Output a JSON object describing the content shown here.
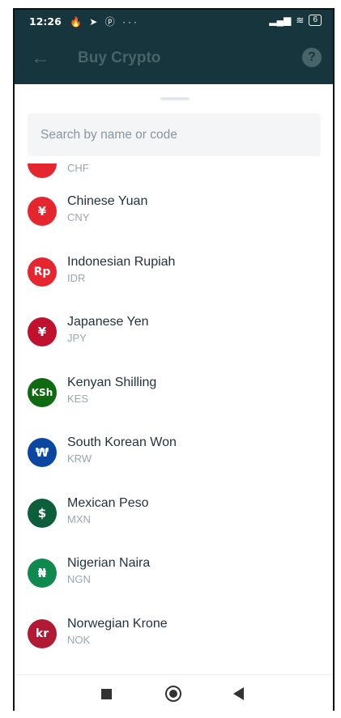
{
  "status_bar": {
    "time": "12:26",
    "left_icons": "🔥 ➤ ⓟ ···",
    "battery": "6"
  },
  "app_bar": {
    "title": "Buy Crypto",
    "back_icon": "arrow-left-icon",
    "help_icon": "question-icon",
    "help_glyph": "?"
  },
  "search": {
    "placeholder": "Search by name or code"
  },
  "partial_item": {
    "code": "CHF",
    "color": "#e5262f"
  },
  "currencies": [
    {
      "name": "Chinese Yuan",
      "code": "CNY",
      "symbol": "¥",
      "color": "#e5262f"
    },
    {
      "name": "Indonesian Rupiah",
      "code": "IDR",
      "symbol": "Rp",
      "color": "#e5262f"
    },
    {
      "name": "Japanese Yen",
      "code": "JPY",
      "symbol": "¥",
      "color": "#c0112f"
    },
    {
      "name": "Kenyan Shilling",
      "code": "KES",
      "symbol": "KSh",
      "color": "#0f6a12"
    },
    {
      "name": "South Korean Won",
      "code": "KRW",
      "symbol": "₩",
      "color": "#0b47a1"
    },
    {
      "name": "Mexican Peso",
      "code": "MXN",
      "symbol": "$",
      "color": "#0d5f3b"
    },
    {
      "name": "Nigerian Naira",
      "code": "NGN",
      "symbol": "₦",
      "color": "#0f8a4e"
    },
    {
      "name": "Norwegian Krone",
      "code": "NOK",
      "symbol": "kr",
      "color": "#b11a32"
    }
  ],
  "nav": {
    "recents_icon": "square-icon",
    "home_icon": "circle-icon",
    "back_icon": "triangle-back-icon"
  }
}
